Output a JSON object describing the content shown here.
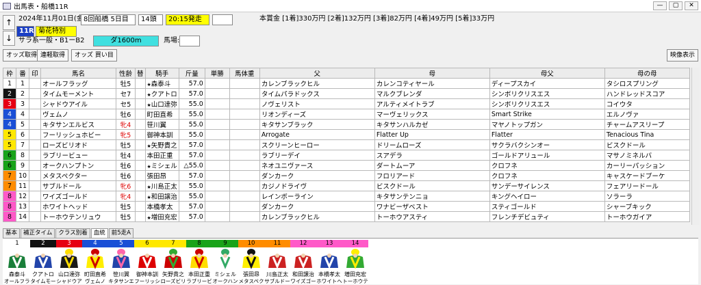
{
  "window": {
    "title": "出馬表・船橋11R",
    "min": "—",
    "max": "▢",
    "close": "✕"
  },
  "header": {
    "date": "2024年11月01日(金)",
    "meeting": "8回船橋 5日目",
    "runners": "14頭",
    "post_time": "20:15発走",
    "prize": "本賞金 [1着]330万円 [2着]132万円 [3着]82万円 [4着]49万円 [5着]33万円",
    "race_no": "11R",
    "race_name": "菊花特別",
    "class": "サラ系一般・B1ーB2",
    "course": "ダ1600m",
    "track_label": "馬場:",
    "up": "↑",
    "down": "↓"
  },
  "toolbar": {
    "odds": "オッズ取得",
    "renban": "連軽取得",
    "odds_buy": "オッズ 買い目",
    "video": "映像表示"
  },
  "columns": [
    "枠",
    "番",
    "印",
    "馬名",
    "性齢",
    "替",
    "騎手",
    "斤量",
    "単勝",
    "馬体重",
    "父",
    "母",
    "母父",
    "母の母"
  ],
  "rows": [
    {
      "waku": "1",
      "ban": "1",
      "name": "オールフラッグ",
      "sexage": "牡5",
      "chg": "",
      "jockey": "森泰斗",
      "marker": "★",
      "wt": "57.0",
      "sire": "カレンブラックヒル",
      "dam": "カレンコティヤール",
      "damsire": "ディープスカイ",
      "damdam": "タシロスプリング"
    },
    {
      "waku": "2",
      "ban": "2",
      "name": "タイムモーメント",
      "sexage": "セ7",
      "chg": "",
      "jockey": "クアトロ",
      "marker": "★",
      "wt": "57.0",
      "sire": "タイムパラドックス",
      "dam": "マルクブレンダ",
      "damsire": "シンボリクリスエス",
      "damdam": "ハンドレッドスコア"
    },
    {
      "waku": "3",
      "ban": "3",
      "name": "シャドウアイル",
      "sexage": "セ5",
      "chg": "",
      "jockey": "山口達弥",
      "marker": "★",
      "wt": "55.0",
      "sire": "ノヴェリスト",
      "dam": "アルティメイトラブ",
      "damsire": "シンボリクリスエス",
      "damdam": "コイウタ"
    },
    {
      "waku": "4",
      "ban": "4",
      "name": "ヴェムノ",
      "sexage": "牡6",
      "chg": "",
      "jockey": "町田直希",
      "marker": "",
      "wt": "55.0",
      "sire": "リオンディーズ",
      "dam": "マーヴェリックス",
      "damsire": "Smart Strike",
      "damdam": "エルノヴァ"
    },
    {
      "waku": "4",
      "ban": "5",
      "name": "キタサンエルビス",
      "sexage": "牝4",
      "chg": "",
      "jockey": "笹川翼",
      "marker": "",
      "wt": "55.0",
      "sire": "キタサンブラック",
      "dam": "キタサンハルカゼ",
      "damsire": "マヤノトップガン",
      "damdam": "チャームアスリープ"
    },
    {
      "waku": "5",
      "ban": "6",
      "name": "フーリッシュホビー",
      "sexage": "牝5",
      "chg": "",
      "jockey": "御神本訓",
      "marker": "",
      "wt": "55.0",
      "sire": "Arrogate",
      "dam": "Flatter Up",
      "damsire": "Flatter",
      "damdam": "Tenacious Tina"
    },
    {
      "waku": "5",
      "ban": "7",
      "name": "ローズビリオド",
      "sexage": "牡5",
      "chg": "",
      "jockey": "矢野貴之",
      "marker": "★",
      "wt": "57.0",
      "sire": "スクリーンヒーロー",
      "dam": "ドリームローズ",
      "damsire": "サクラバクシンオー",
      "damdam": "ビスクドール"
    },
    {
      "waku": "6",
      "ban": "8",
      "name": "ラブリービュー",
      "sexage": "牡4",
      "chg": "",
      "jockey": "本田正重",
      "marker": "",
      "wt": "57.0",
      "sire": "ラブリーデイ",
      "dam": "スアデラ",
      "damsire": "ゴールドアリュール",
      "damdam": "マサノミネルバ"
    },
    {
      "waku": "6",
      "ban": "9",
      "name": "オークハンプトン",
      "sexage": "牡6",
      "chg": "",
      "jockey": "ミシェル",
      "marker": "★",
      "wt": "△55.0",
      "sire": "ネオユニヴァース",
      "dam": "ダートムーア",
      "damsire": "クロフネ",
      "damdam": "カーリーパッション"
    },
    {
      "waku": "7",
      "ban": "10",
      "name": "メタスペクター",
      "sexage": "牡6",
      "chg": "",
      "jockey": "張田昂",
      "marker": "",
      "wt": "57.0",
      "sire": "ダンカーク",
      "dam": "フロリアード",
      "damsire": "クロフネ",
      "damdam": "キャスケードブーケ"
    },
    {
      "waku": "7",
      "ban": "11",
      "name": "サブルドール",
      "sexage": "牝6",
      "chg": "",
      "jockey": "川島正太",
      "marker": "★",
      "wt": "55.0",
      "sire": "カジノドライヴ",
      "dam": "ビスクドール",
      "damsire": "サンデーサイレンス",
      "damdam": "フェアリードール"
    },
    {
      "waku": "8",
      "ban": "12",
      "name": "ワイズゴールド",
      "sexage": "牝4",
      "chg": "",
      "jockey": "和田譲治",
      "marker": "★",
      "wt": "55.0",
      "sire": "レインボーライン",
      "dam": "キタサンテンニョ",
      "damsire": "キングヘイロー",
      "damdam": "ソラーラ"
    },
    {
      "waku": "8",
      "ban": "13",
      "name": "ホワイトヘッド",
      "sexage": "牡5",
      "chg": "",
      "jockey": "本橋孝太",
      "marker": "",
      "wt": "57.0",
      "sire": "ダンカーク",
      "dam": "ワナビーザベスト",
      "damsire": "スティゴールド",
      "damdam": "シャーブキック"
    },
    {
      "waku": "8",
      "ban": "14",
      "name": "トーホウテンリュウ",
      "sexage": "牡5",
      "chg": "",
      "jockey": "増田充宏",
      "marker": "★",
      "wt": "57.0",
      "sire": "カレンブラックヒル",
      "dam": "トーホウアスティ",
      "damsire": "フレンチデビュティ",
      "damdam": "トーホウガイア"
    }
  ],
  "tabs": [
    "基本",
    "補正タイム",
    "クラス別着",
    "血統",
    "前5走A"
  ],
  "jockeys": [
    {
      "num": "1",
      "jk": "森泰斗",
      "horse": "オールフラッ"
    },
    {
      "num": "2",
      "jk": "クアトロ",
      "horse": "タイムモー"
    },
    {
      "num": "3",
      "jk": "山口達弥",
      "horse": "シャドウア"
    },
    {
      "num": "4",
      "jk": "町田直希",
      "horse": "ヴェムノ"
    },
    {
      "num": "5",
      "jk": "笹川翼",
      "horse": "キタサンエ"
    },
    {
      "num": "6",
      "jk": "御神本訓",
      "horse": "フーリッシ"
    },
    {
      "num": "7",
      "jk": "矢野貴之",
      "horse": "ローズビリ"
    },
    {
      "num": "8",
      "jk": "本田正重",
      "horse": "ラブリービ"
    },
    {
      "num": "9",
      "jk": "ミシェル",
      "horse": "オークハン"
    },
    {
      "num": "10",
      "jk": "張田昂",
      "horse": "メタスペク"
    },
    {
      "num": "11",
      "jk": "川島正太",
      "horse": "サブルドー"
    },
    {
      "num": "12",
      "jk": "和田譲治",
      "horse": "ワイズゴー"
    },
    {
      "num": "13",
      "jk": "本橋孝太",
      "horse": "ホワイトヘ"
    },
    {
      "num": "14",
      "jk": "増田充宏",
      "horse": "トーホウテ"
    }
  ],
  "waku_colors": {
    "1": "#ffffff",
    "2": "#111111",
    "3": "#e60012",
    "4": "#1a4fd6",
    "5": "#ffe800",
    "6": "#19a319",
    "7": "#ff8c00",
    "8": "#ff59c8"
  },
  "silk_colors": [
    [
      "#1a7f3a",
      "#ffffff"
    ],
    [
      "#2244aa",
      "#ffffff"
    ],
    [
      "#1a1a1a",
      "#ffdd00"
    ],
    [
      "#ffee00",
      "#cc0000"
    ],
    [
      "#2244aa",
      "#ff66aa"
    ],
    [
      "#dd0000",
      "#ffffff"
    ],
    [
      "#cc0000",
      "#33aa33"
    ],
    [
      "#ffdd00",
      "#cc0000"
    ],
    [
      "#ffffff",
      "#33aa66"
    ],
    [
      "#ffee00",
      "#111111"
    ],
    [
      "#cc2222",
      "#ffffff"
    ],
    [
      "#cc2222",
      "#ffffff"
    ],
    [
      "#2244aa",
      "#ffffff"
    ],
    [
      "#33aa33",
      "#ffee00"
    ]
  ]
}
